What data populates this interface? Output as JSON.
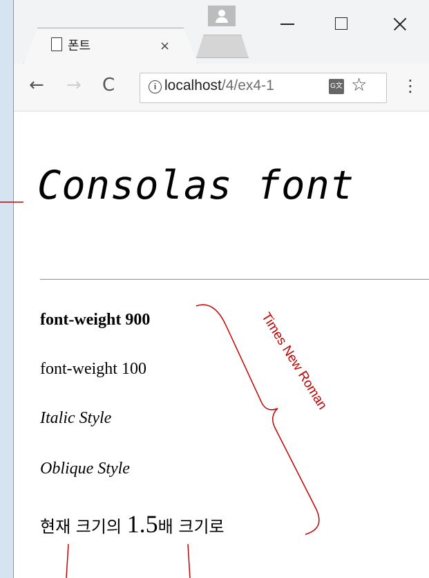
{
  "browser": {
    "tab": {
      "title": "폰트",
      "close_icon": "close-icon"
    },
    "window_controls": {
      "minimize": "minimize-icon",
      "maximize": "maximize-icon",
      "close": "close-icon"
    },
    "toolbar": {
      "back": "←",
      "forward": "→",
      "reload": "C",
      "address": {
        "host": "localhost",
        "path": "/4/ex4-1"
      },
      "star": "☆",
      "menu": "⋮"
    }
  },
  "page": {
    "heading": "Consolas font",
    "lines": [
      "font-weight 900",
      "font-weight 100",
      "Italic Style",
      "Oblique Style"
    ],
    "size_line": {
      "before": "현재 크기의 ",
      "big": "1.5",
      "big_tail": "배",
      "after": " 크기로"
    }
  },
  "annotation": {
    "label": "Times New Roman",
    "color": "#c00000"
  }
}
